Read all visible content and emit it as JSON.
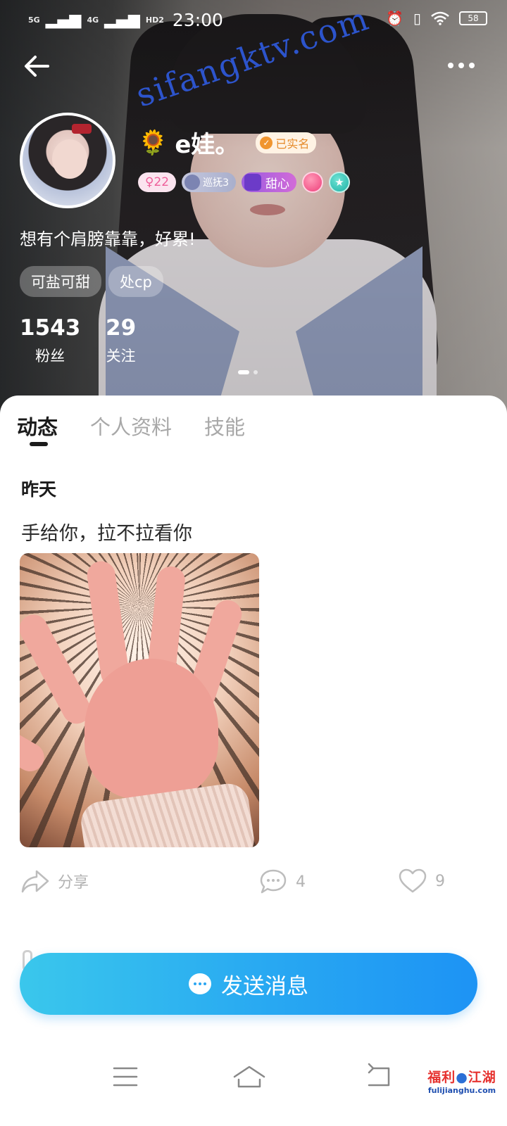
{
  "status_bar": {
    "signal_1": "5G",
    "signal_2": "4G",
    "hd": "HD2",
    "time": "23:00",
    "battery": "58"
  },
  "watermark": "sifangktv.com",
  "profile": {
    "name_emoji": "🌻",
    "name": "e娃。",
    "verified_label": "已实名",
    "badges": {
      "age": "22",
      "guard": "巡抚3",
      "sweet": "甜心",
      "teal_icon": "★"
    },
    "signature": "想有个肩膀靠靠，好累!",
    "tags": [
      "可盐可甜",
      "处cp"
    ],
    "stats": {
      "fans_count": "1543",
      "fans_label": "粉丝",
      "follow_count": "29",
      "follow_label": "关注"
    },
    "pager": {
      "count": 2,
      "active": 1
    }
  },
  "tabs": {
    "dynamic": "动态",
    "profile": "个人资料",
    "skills": "技能",
    "active": "dynamic"
  },
  "post": {
    "date": "昨天",
    "text": "手给你，拉不拉看你",
    "share_label": "分享",
    "comment_count": "4",
    "like_count": "9"
  },
  "cta": {
    "send_message": "发送消息"
  },
  "corner_logo": {
    "cn_1": "福利",
    "cn_2": "江湖",
    "en": "fulijianghu.com"
  },
  "icons": [
    "back-arrow-icon",
    "more-dots-icon",
    "share-icon",
    "comment-icon",
    "heart-icon",
    "chat-bubble-icon",
    "menu-icon",
    "home-icon",
    "back-nav-icon"
  ],
  "colors": {
    "send_button_start": "#3ac7ec",
    "send_button_end": "#1d93f4",
    "verified": "#e58a2a",
    "age_badge": "#ee5f9a"
  }
}
